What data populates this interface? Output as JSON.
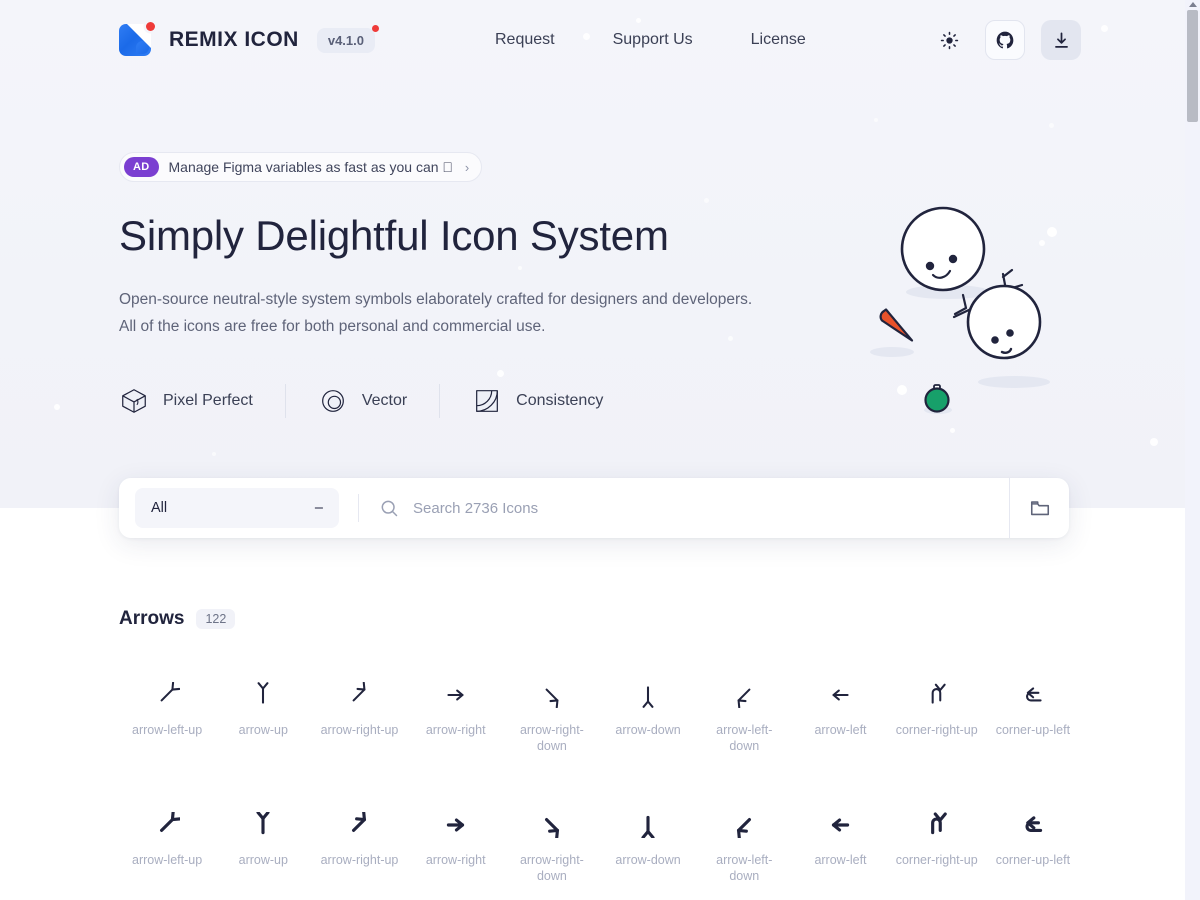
{
  "header": {
    "brand_name": "REMIX ICON",
    "version": "v4.1.0",
    "nav": [
      {
        "label": "Request"
      },
      {
        "label": "Support Us"
      },
      {
        "label": "License"
      }
    ],
    "tools": [
      {
        "name": "theme-toggle",
        "icon": "sun-icon"
      },
      {
        "name": "github-link",
        "icon": "github-icon"
      },
      {
        "name": "download-button",
        "icon": "download-icon"
      }
    ]
  },
  "hero": {
    "ad": {
      "badge": "AD",
      "text": "Manage Figma variables as fast as you can ",
      "arrow": "›"
    },
    "title": "Simply Delightful Icon System",
    "subtitle_line1": "Open-source neutral-style system symbols elaborately crafted for designers and developers.",
    "subtitle_line2": "All of the icons are free for both personal and commercial use.",
    "features": [
      {
        "label": "Pixel Perfect",
        "icon": "cube-icon"
      },
      {
        "label": "Vector",
        "icon": "circles-icon"
      },
      {
        "label": "Consistency",
        "icon": "square-curve-icon"
      }
    ]
  },
  "search": {
    "category_label": "All",
    "category_marker": "–",
    "placeholder": "Search 2736 Icons",
    "value": "",
    "search_icon": "search-icon",
    "folder_icon": "folder-icon"
  },
  "section": {
    "title": "Arrows",
    "count": "122"
  },
  "icons": {
    "row1": [
      {
        "name": "arrow-left-up",
        "style": "line"
      },
      {
        "name": "arrow-up",
        "style": "line"
      },
      {
        "name": "arrow-right-up",
        "style": "line"
      },
      {
        "name": "arrow-right",
        "style": "line"
      },
      {
        "name": "arrow-right-down",
        "style": "line"
      },
      {
        "name": "arrow-down",
        "style": "line"
      },
      {
        "name": "arrow-left-down",
        "style": "line"
      },
      {
        "name": "arrow-left",
        "style": "line"
      },
      {
        "name": "corner-right-up",
        "style": "line"
      },
      {
        "name": "corner-up-left",
        "style": "line"
      }
    ],
    "row2": [
      {
        "name": "arrow-left-up",
        "style": "fill"
      },
      {
        "name": "arrow-up",
        "style": "fill"
      },
      {
        "name": "arrow-right-up",
        "style": "fill"
      },
      {
        "name": "arrow-right",
        "style": "fill"
      },
      {
        "name": "arrow-right-down",
        "style": "fill"
      },
      {
        "name": "arrow-down",
        "style": "fill"
      },
      {
        "name": "arrow-left-down",
        "style": "fill"
      },
      {
        "name": "arrow-left",
        "style": "fill"
      },
      {
        "name": "corner-right-up",
        "style": "fill"
      },
      {
        "name": "corner-up-left",
        "style": "fill"
      }
    ]
  },
  "colors": {
    "brand_blue": "#2f7df4",
    "accent_red": "#ef3b39",
    "ad_purple": "#7b3fd1",
    "ink": "#21243d",
    "muted": "#a9aec0",
    "hero_bg": "#f2f3f9",
    "carrot": "#e8522b",
    "ornament_green": "#17a06a"
  },
  "scrollbar": {
    "visible": true
  }
}
